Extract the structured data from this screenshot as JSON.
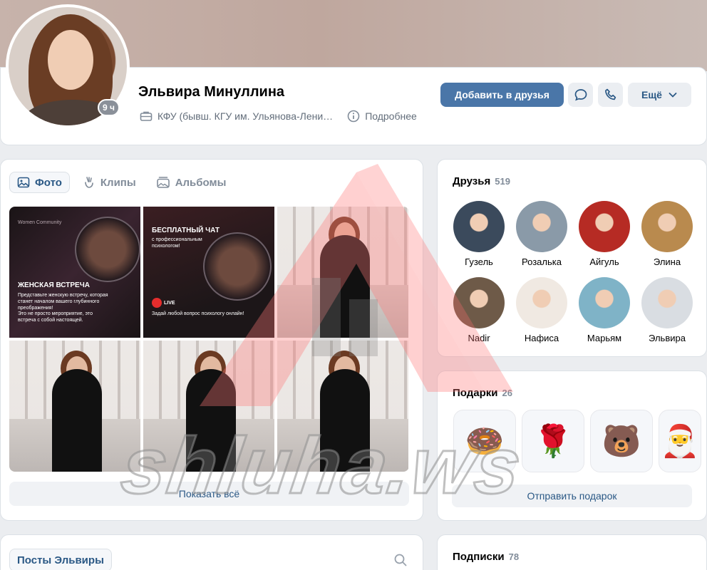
{
  "profile": {
    "name": "Эльвира Минуллина",
    "last_seen_badge": "9 ч",
    "education": "КФУ (бывш. КГУ им. Ульянова-Лени…",
    "details_label": "Подробнее",
    "add_friend_label": "Добавить в друзья",
    "more_label": "Ещё"
  },
  "photos": {
    "tabs": [
      {
        "label": "Фото",
        "active": true
      },
      {
        "label": "Клипы",
        "active": false
      },
      {
        "label": "Альбомы",
        "active": false
      }
    ],
    "items": [
      {
        "kind": "promo1",
        "brand": "Women Community",
        "title": "ЖЕНСКАЯ ВСТРЕЧА",
        "text1": "Представьте женскую встречу, которая станет началом вашего глубинного преображения!",
        "text2": "Это не просто мероприятие, это встреча с собой настоящей."
      },
      {
        "kind": "promo2",
        "title": "БЕСПЛАТНЫЙ ЧАТ",
        "subtitle": "с профессиональным психологом!",
        "live": "LIVE",
        "footer": "Задай любой вопрос психологу онлайн!"
      },
      {
        "kind": "street"
      },
      {
        "kind": "street"
      },
      {
        "kind": "street"
      },
      {
        "kind": "street"
      }
    ],
    "show_all_label": "Показать всё"
  },
  "friends": {
    "title": "Друзья",
    "count": "519",
    "items": [
      {
        "name": "Гузель",
        "color": "#3b4a5c"
      },
      {
        "name": "Розалька",
        "color": "#8a9aa8"
      },
      {
        "name": "Айгуль",
        "color": "#b62b24"
      },
      {
        "name": "Элина",
        "color": "#b98a4e"
      },
      {
        "name": "Nadir",
        "color": "#6e5a48"
      },
      {
        "name": "Нафиса",
        "color": "#f0e9e2"
      },
      {
        "name": "Марьям",
        "color": "#7fb3c7"
      },
      {
        "name": "Эльвира",
        "color": "#d9dde2"
      }
    ]
  },
  "gifts": {
    "title": "Подарки",
    "count": "26",
    "items": [
      "🍩",
      "🌹",
      "🐻",
      "🎅"
    ],
    "send_label": "Отправить подарок"
  },
  "posts": {
    "tab_label": "Посты Эльвиры"
  },
  "subscriptions": {
    "title": "Подписки",
    "count": "78"
  },
  "watermark": {
    "text": "shluha.ws"
  }
}
